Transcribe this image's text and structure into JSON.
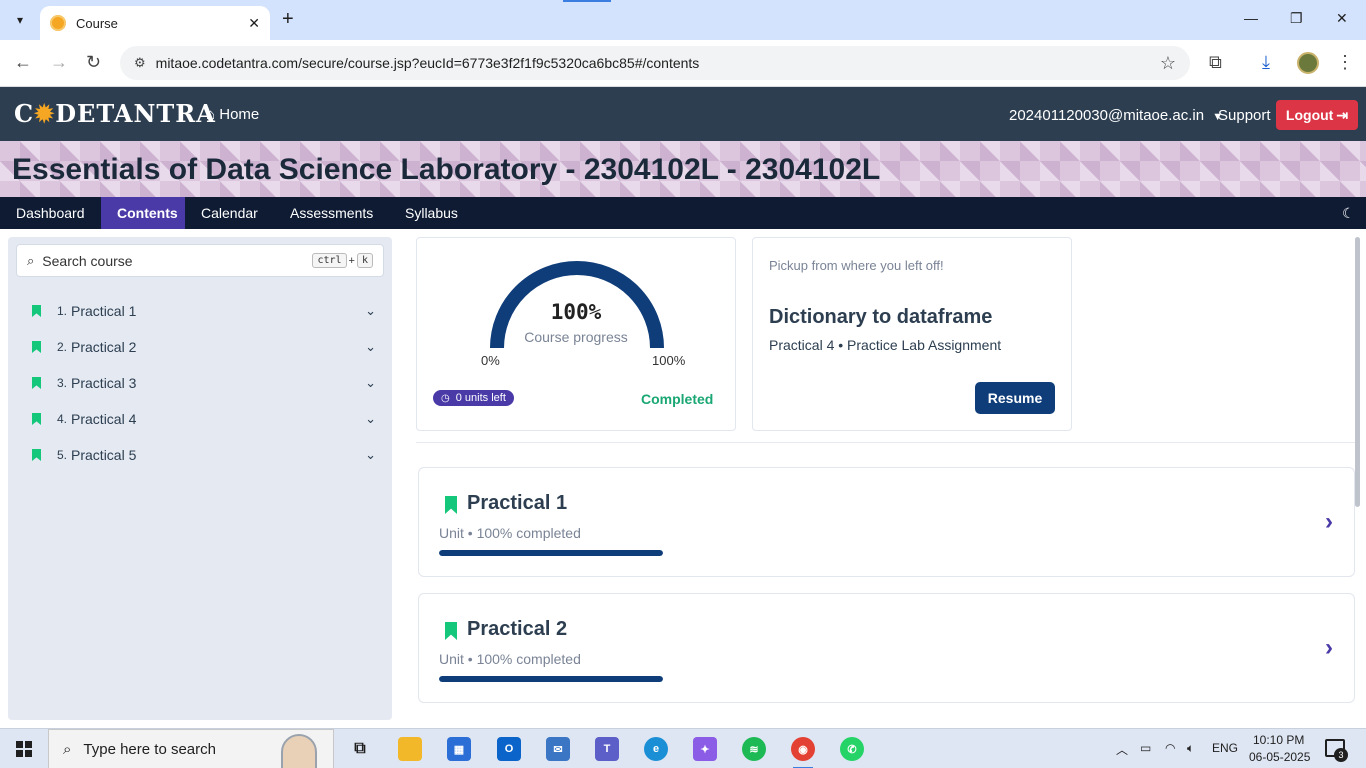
{
  "browser": {
    "tab_title": "Course",
    "url": "mitaoe.codetantra.com/secure/course.jsp?eucId=6773e3f2f1f9c5320ca6bc85#/contents"
  },
  "header": {
    "logo_prefix": "C",
    "logo_suffix": "DETANTRA",
    "home_label": "Home",
    "user_email": "202401120030@mitaoe.ac.in",
    "support_label": "Support",
    "logout_label": "Logout"
  },
  "course": {
    "title": "Essentials of Data Science Laboratory - 2304102L - 2304102L"
  },
  "subnav": {
    "items": [
      {
        "label": "Dashboard"
      },
      {
        "label": "Contents"
      },
      {
        "label": "Calendar"
      },
      {
        "label": "Assessments"
      },
      {
        "label": "Syllabus"
      }
    ],
    "active": "Contents"
  },
  "sidebar": {
    "search_placeholder": "Search course",
    "shortcut_ctrl": "ctrl",
    "shortcut_plus": "+",
    "shortcut_key": "k",
    "items": [
      {
        "num": "1.",
        "label": "Practical 1"
      },
      {
        "num": "2.",
        "label": "Practical 2"
      },
      {
        "num": "3.",
        "label": "Practical 3"
      },
      {
        "num": "4.",
        "label": "Practical 4"
      },
      {
        "num": "5.",
        "label": "Practical 5"
      }
    ]
  },
  "progress": {
    "value": 100,
    "percent_text": "100%",
    "label": "Course progress",
    "min_label": "0%",
    "max_label": "100%",
    "units_left": "0 units left",
    "status": "Completed"
  },
  "resume": {
    "prompt": "Pickup from where you left off!",
    "title": "Dictionary to dataframe",
    "subtitle": "Practical 4 • Practice Lab Assignment",
    "button_label": "Resume"
  },
  "units": [
    {
      "title": "Practical 1",
      "subtitle": "Unit • 100% completed",
      "progress": 1.0
    },
    {
      "title": "Practical 2",
      "subtitle": "Unit • 100% completed",
      "progress": 1.0
    }
  ],
  "taskbar": {
    "search_placeholder": "Type here to search",
    "language": "ENG",
    "time": "10:10 PM",
    "date": "06-05-2025",
    "notification_count": "3"
  },
  "colors": {
    "header_bg": "#2c3e50",
    "accent_purple": "#4a3aa8",
    "progress_blue": "#0f3d7a",
    "success_green": "#1aa774",
    "logout_red": "#dc3545"
  }
}
